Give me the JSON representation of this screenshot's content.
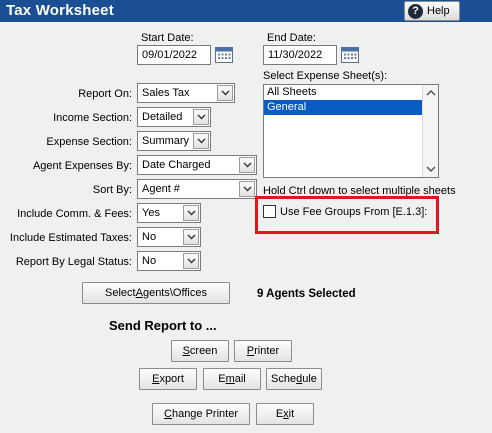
{
  "window": {
    "title": "Tax Worksheet",
    "help_label": "Help",
    "help_glyph": "?"
  },
  "dates": {
    "start_label": "Start Date:",
    "start_value": "09/01/2022",
    "end_label": "End Date:",
    "end_value": "11/30/2022"
  },
  "expense_sheets": {
    "label": "Select Expense Sheet(s):",
    "items": [
      {
        "label": "All Sheets",
        "selected": false
      },
      {
        "label": "General",
        "selected": true
      }
    ],
    "hint": "Hold Ctrl down to select multiple sheets"
  },
  "fields": {
    "report_on": {
      "label": "Report On:",
      "value": "Sales Tax"
    },
    "income_section": {
      "label": "Income Section:",
      "value": "Detailed"
    },
    "expense_section": {
      "label": "Expense Section:",
      "value": "Summary"
    },
    "agent_expenses_by": {
      "label": "Agent Expenses By:",
      "value": "Date Charged"
    },
    "sort_by": {
      "label": "Sort By:",
      "value": "Agent #"
    },
    "include_comm_fees": {
      "label": "Include Comm. & Fees:",
      "value": "Yes"
    },
    "include_est_taxes": {
      "label": "Include Estimated Taxes:",
      "value": "No"
    },
    "report_by_legal_status": {
      "label": "Report By Legal Status:",
      "value": "No"
    }
  },
  "fee_groups": {
    "label": "Use Fee Groups From [E.1.3]:",
    "checked": false
  },
  "agents": {
    "select_button_pre": "Select ",
    "select_button_u": "A",
    "select_button_post": "gents\\Offices",
    "selected_text": "9 Agents Selected"
  },
  "send_report": {
    "heading": "Send Report to ...",
    "screen_u": "S",
    "screen_rest": "creen",
    "printer_u": "P",
    "printer_rest": "rinter",
    "export_u": "E",
    "export_rest": "xport",
    "email_pre": "E",
    "email_u": "m",
    "email_rest": "ail",
    "schedule_pre": "Sche",
    "schedule_u": "d",
    "schedule_rest": "ule",
    "change_printer_u": "C",
    "change_printer_rest": "hange Printer",
    "exit_pre": "E",
    "exit_u": "x",
    "exit_rest": "it"
  },
  "colors": {
    "titlebar": "#1b4f93",
    "selection": "#0a5bc4",
    "highlight": "#e2161e"
  }
}
